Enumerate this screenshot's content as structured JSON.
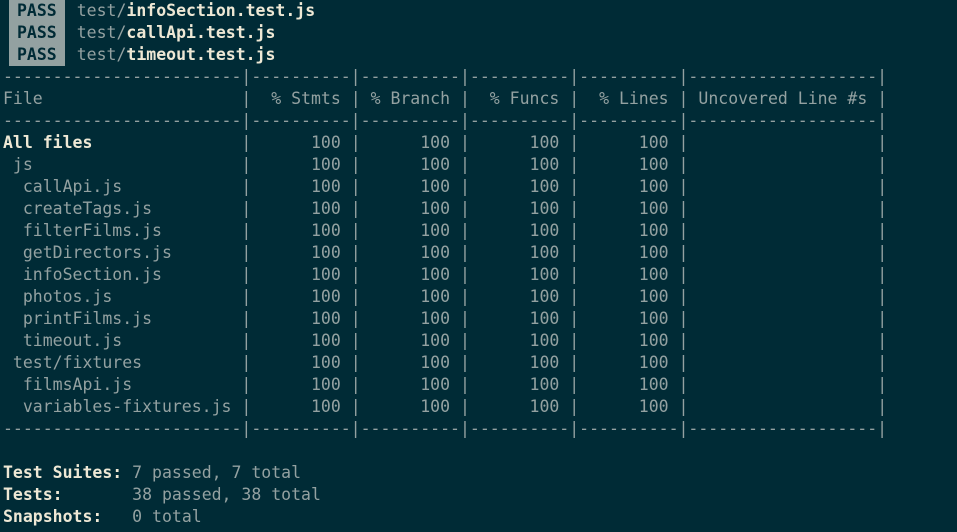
{
  "pass_results": [
    {
      "badge": "PASS",
      "dir": "test/",
      "file": "infoSection.test.js"
    },
    {
      "badge": "PASS",
      "dir": "test/",
      "file": "callApi.test.js"
    },
    {
      "badge": "PASS",
      "dir": "test/",
      "file": "timeout.test.js"
    }
  ],
  "coverage_table": {
    "headers": [
      "File",
      "% Stmts",
      "% Branch",
      "% Funcs",
      "% Lines",
      "Uncovered Line #s"
    ],
    "rows": [
      {
        "file": "All files",
        "indent": 0,
        "stmts": "100",
        "branch": "100",
        "funcs": "100",
        "lines": "100",
        "uncovered": ""
      },
      {
        "file": "js",
        "indent": 1,
        "stmts": "100",
        "branch": "100",
        "funcs": "100",
        "lines": "100",
        "uncovered": ""
      },
      {
        "file": "callApi.js",
        "indent": 2,
        "stmts": "100",
        "branch": "100",
        "funcs": "100",
        "lines": "100",
        "uncovered": ""
      },
      {
        "file": "createTags.js",
        "indent": 2,
        "stmts": "100",
        "branch": "100",
        "funcs": "100",
        "lines": "100",
        "uncovered": ""
      },
      {
        "file": "filterFilms.js",
        "indent": 2,
        "stmts": "100",
        "branch": "100",
        "funcs": "100",
        "lines": "100",
        "uncovered": ""
      },
      {
        "file": "getDirectors.js",
        "indent": 2,
        "stmts": "100",
        "branch": "100",
        "funcs": "100",
        "lines": "100",
        "uncovered": ""
      },
      {
        "file": "infoSection.js",
        "indent": 2,
        "stmts": "100",
        "branch": "100",
        "funcs": "100",
        "lines": "100",
        "uncovered": ""
      },
      {
        "file": "photos.js",
        "indent": 2,
        "stmts": "100",
        "branch": "100",
        "funcs": "100",
        "lines": "100",
        "uncovered": ""
      },
      {
        "file": "printFilms.js",
        "indent": 2,
        "stmts": "100",
        "branch": "100",
        "funcs": "100",
        "lines": "100",
        "uncovered": ""
      },
      {
        "file": "timeout.js",
        "indent": 2,
        "stmts": "100",
        "branch": "100",
        "funcs": "100",
        "lines": "100",
        "uncovered": ""
      },
      {
        "file": "test/fixtures",
        "indent": 1,
        "stmts": "100",
        "branch": "100",
        "funcs": "100",
        "lines": "100",
        "uncovered": ""
      },
      {
        "file": "filmsApi.js",
        "indent": 2,
        "stmts": "100",
        "branch": "100",
        "funcs": "100",
        "lines": "100",
        "uncovered": ""
      },
      {
        "file": "variables-fixtures.js",
        "indent": 2,
        "stmts": "100",
        "branch": "100",
        "funcs": "100",
        "lines": "100",
        "uncovered": ""
      }
    ]
  },
  "summary": {
    "test_suites_label": "Test Suites:",
    "test_suites_value": "7 passed, 7 total",
    "tests_label": "Tests:",
    "tests_value": "38 passed, 38 total",
    "snapshots_label": "Snapshots:",
    "snapshots_value": "0 total"
  },
  "colors": {
    "background": "#002b36",
    "text": "#93a1a1",
    "bold_text": "#eee8d5",
    "badge_bg": "#93a1a1"
  }
}
